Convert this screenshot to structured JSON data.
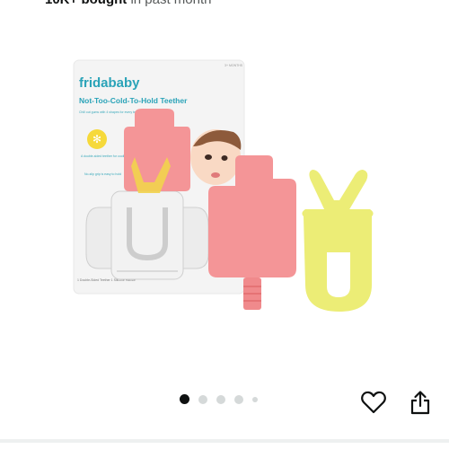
{
  "purchase_info": {
    "count": "10K+",
    "bought_word": "bought",
    "suffix": "in past month"
  },
  "product_image": {
    "alt": "Frida Baby Not-Too-Cold-To-Hold Teether",
    "package": {
      "brand": "fridababy",
      "age_label": "3+ MONTHS",
      "title": "Not-Too-Cold-To-Hold Teether",
      "description": "Chill out gums with 4 shapes for every teething phase",
      "callout_1": "A double-sided teether for cooling relief",
      "callout_2": "No-slip grip is easy to hold",
      "footer": "1 Double-Sided Teether 1 Silicone Handle"
    }
  },
  "carousel": {
    "total": 5,
    "active_index": 0
  },
  "colors": {
    "active_dot": "#0f1111",
    "inactive_dot": "#d5d9d9",
    "teether_pink": "#f49597",
    "teether_yellow": "#eced76",
    "brand_teal": "#2aa3b8"
  },
  "actions": {
    "wishlist_icon": "heart-outline-icon",
    "share_icon": "share-icon"
  }
}
